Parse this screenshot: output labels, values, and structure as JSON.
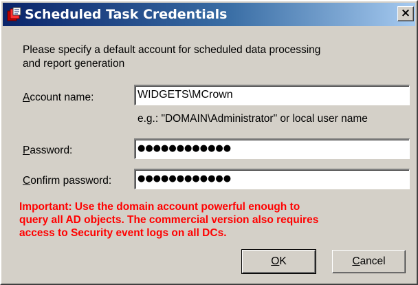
{
  "window": {
    "title": "Scheduled Task Credentials",
    "close_glyph": "×"
  },
  "intro_text": "Please specify a default account for scheduled data processing\nand report generation",
  "fields": {
    "account": {
      "label_accel": "A",
      "label_rest": "ccount name:",
      "value": "WIDGETS\\MCrown",
      "hint": "e.g.: \"DOMAIN\\Administrator\" or local user name"
    },
    "password": {
      "label_accel": "P",
      "label_rest": "assword:",
      "value": "●●●●●●●●●●●●"
    },
    "confirm": {
      "label_accel": "C",
      "label_rest": "onfirm password:",
      "value": "●●●●●●●●●●●●"
    }
  },
  "warning_text": "Important: Use the domain account powerful enough to\nquery all AD objects. The commercial version also requires\naccess to Security event logs on all DCs.",
  "buttons": {
    "ok_accel": "O",
    "ok_rest": "K",
    "cancel_accel": "C",
    "cancel_rest": "ancel"
  },
  "colors": {
    "titlebar_start": "#0a246a",
    "titlebar_end": "#a6caf0",
    "warning": "#ff0000",
    "face": "#d4d0c8"
  },
  "icons": {
    "title_icon": "app-icon",
    "close": "close-icon"
  }
}
